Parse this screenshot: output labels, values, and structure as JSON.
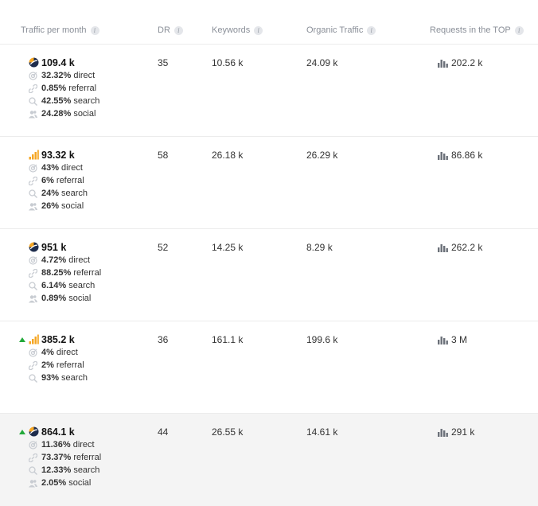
{
  "headers": {
    "traffic": "Traffic per month",
    "dr": "DR",
    "keywords": "Keywords",
    "organic": "Organic Traffic",
    "requests": "Requests in the TOP"
  },
  "info_glyph": "i",
  "rows": [
    {
      "trend": "none",
      "source_icon": "similarweb-icon",
      "total": "109.4 k",
      "channels": [
        {
          "icon": "target-icon",
          "pct": "32.32%",
          "label": "direct"
        },
        {
          "icon": "link-icon",
          "pct": "0.85%",
          "label": "referral"
        },
        {
          "icon": "search-icon",
          "pct": "42.55%",
          "label": "search"
        },
        {
          "icon": "users-icon",
          "pct": "24.28%",
          "label": "social"
        }
      ],
      "dr": "35",
      "keywords": "10.56 k",
      "organic": "24.09 k",
      "requests": "202.2 k",
      "highlight": false
    },
    {
      "trend": "none",
      "source_icon": "signal-bars-icon",
      "total": "93.32 k",
      "channels": [
        {
          "icon": "target-icon",
          "pct": "43%",
          "label": "direct"
        },
        {
          "icon": "link-icon",
          "pct": "6%",
          "label": "referral"
        },
        {
          "icon": "search-icon",
          "pct": "24%",
          "label": "search"
        },
        {
          "icon": "users-icon",
          "pct": "26%",
          "label": "social"
        }
      ],
      "dr": "58",
      "keywords": "26.18 k",
      "organic": "26.29 k",
      "requests": "86.86 k",
      "highlight": false
    },
    {
      "trend": "none",
      "source_icon": "similarweb-icon",
      "total": "951 k",
      "channels": [
        {
          "icon": "target-icon",
          "pct": "4.72%",
          "label": "direct"
        },
        {
          "icon": "link-icon",
          "pct": "88.25%",
          "label": "referral"
        },
        {
          "icon": "search-icon",
          "pct": "6.14%",
          "label": "search"
        },
        {
          "icon": "users-icon",
          "pct": "0.89%",
          "label": "social"
        }
      ],
      "dr": "52",
      "keywords": "14.25 k",
      "organic": "8.29 k",
      "requests": "262.2 k",
      "highlight": false
    },
    {
      "trend": "up",
      "source_icon": "signal-bars-icon",
      "total": "385.2 k",
      "channels": [
        {
          "icon": "target-icon",
          "pct": "4%",
          "label": "direct"
        },
        {
          "icon": "link-icon",
          "pct": "2%",
          "label": "referral"
        },
        {
          "icon": "search-icon",
          "pct": "93%",
          "label": "search"
        }
      ],
      "dr": "36",
      "keywords": "161.1 k",
      "organic": "199.6 k",
      "requests": "3 M",
      "highlight": false
    },
    {
      "trend": "up",
      "source_icon": "similarweb-icon",
      "total": "864.1 k",
      "channels": [
        {
          "icon": "target-icon",
          "pct": "11.36%",
          "label": "direct"
        },
        {
          "icon": "link-icon",
          "pct": "73.37%",
          "label": "referral"
        },
        {
          "icon": "search-icon",
          "pct": "12.33%",
          "label": "search"
        },
        {
          "icon": "users-icon",
          "pct": "2.05%",
          "label": "social"
        }
      ],
      "dr": "44",
      "keywords": "26.55 k",
      "organic": "14.61 k",
      "requests": "291 k",
      "highlight": true
    }
  ],
  "colors": {
    "accent_orange": "#f5a623",
    "navy": "#1f2d4d",
    "trend_up": "#22a93a",
    "muted_icon": "#c8ccd2",
    "header_text": "#8a8f98",
    "highlight_row": "#f4f4f4"
  }
}
